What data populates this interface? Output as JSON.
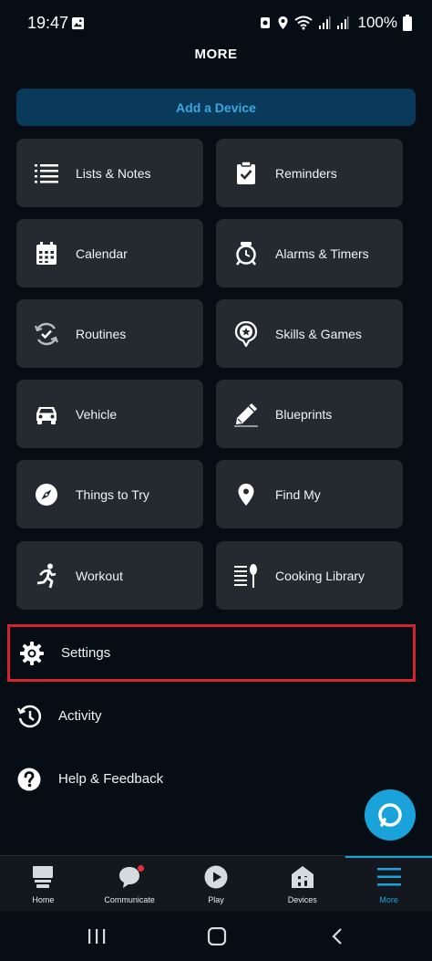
{
  "status_bar": {
    "time": "19:47",
    "battery": "100%"
  },
  "header": {
    "title": "MORE"
  },
  "add_device": {
    "label": "Add a Device"
  },
  "tiles": [
    {
      "label": "Lists & Notes",
      "icon": "list-icon"
    },
    {
      "label": "Reminders",
      "icon": "clipboard-check-icon"
    },
    {
      "label": "Calendar",
      "icon": "calendar-icon"
    },
    {
      "label": "Alarms & Timers",
      "icon": "alarm-clock-icon"
    },
    {
      "label": "Routines",
      "icon": "routines-icon"
    },
    {
      "label": "Skills & Games",
      "icon": "skills-icon"
    },
    {
      "label": "Vehicle",
      "icon": "car-icon"
    },
    {
      "label": "Blueprints",
      "icon": "pencil-icon"
    },
    {
      "label": "Things to Try",
      "icon": "compass-icon"
    },
    {
      "label": "Find My",
      "icon": "location-pin-icon"
    },
    {
      "label": "Workout",
      "icon": "running-icon"
    },
    {
      "label": "Cooking Library",
      "icon": "cooking-icon"
    }
  ],
  "list_rows": [
    {
      "label": "Settings",
      "icon": "gear-icon",
      "highlighted": true
    },
    {
      "label": "Activity",
      "icon": "history-icon"
    },
    {
      "label": "Help & Feedback",
      "icon": "help-icon"
    }
  ],
  "bottom_nav": [
    {
      "label": "Home",
      "icon": "home-icon"
    },
    {
      "label": "Communicate",
      "icon": "chat-icon",
      "badge": true
    },
    {
      "label": "Play",
      "icon": "play-icon"
    },
    {
      "label": "Devices",
      "icon": "devices-icon"
    },
    {
      "label": "More",
      "icon": "menu-icon",
      "active": true
    }
  ],
  "colors": {
    "background": "#070d15",
    "tile": "#252a30",
    "accent": "#1aa3db",
    "highlight_border": "#d6222c",
    "add_device_bg": "#0a3a5a"
  }
}
